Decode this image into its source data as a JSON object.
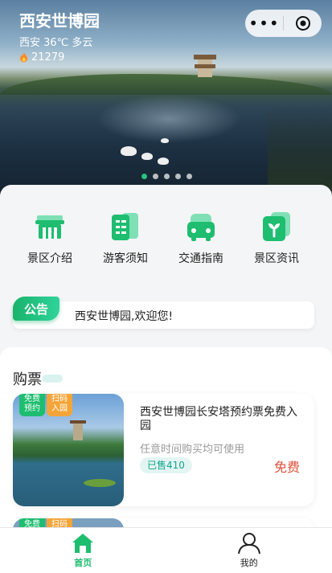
{
  "hero": {
    "title": "西安世博园",
    "weather": "西安 36℃ 多云",
    "heat": "21279",
    "carousel_dots": 5,
    "active_dot": 0
  },
  "capsule": {
    "more_icon": "ellipsis-icon",
    "close_icon": "target-close-icon"
  },
  "grid": [
    {
      "label": "景区介绍",
      "icon": "scenic-gate-icon"
    },
    {
      "label": "游客须知",
      "icon": "book-icon"
    },
    {
      "label": "交通指南",
      "icon": "car-icon"
    },
    {
      "label": "景区资讯",
      "icon": "sprout-icon"
    }
  ],
  "notice": {
    "tag": "公告",
    "text": "西安世博园,欢迎您!"
  },
  "tickets": {
    "section_title": "购票",
    "items": [
      {
        "badge_left": "免费预约",
        "badge_right": "扫码入园",
        "name": "西安世博园长安塔预约票免费入园",
        "note": "任意时间购买均可使用",
        "sold": "已售410",
        "price": "免费"
      },
      {
        "badge_left": "免费",
        "badge_right": "扫码"
      }
    ]
  },
  "tabbar": {
    "tabs": [
      {
        "label": "首页",
        "icon": "home-icon",
        "active": true
      },
      {
        "label": "我的",
        "icon": "user-icon",
        "active": false
      }
    ]
  },
  "colors": {
    "accent": "#1ebd6f",
    "price": "#e0513c",
    "sold_text": "#14a58c",
    "badge_orange": "#f4a53a"
  }
}
